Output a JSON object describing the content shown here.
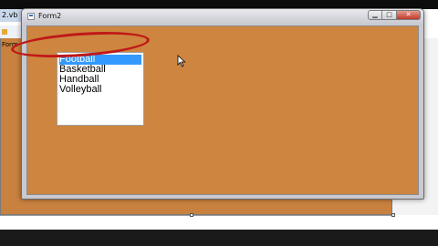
{
  "ide": {
    "document_tab": "2.vb",
    "form_tab": "Form"
  },
  "window": {
    "title": "Form2",
    "controls": {
      "minimize": "▁",
      "maximize": "□",
      "close": "✕"
    }
  },
  "listbox": {
    "items": [
      "Football",
      "Basketball",
      "Handball",
      "Volleyball"
    ],
    "selected_index": 0
  },
  "colors": {
    "form_background": "#cd853f",
    "selection": "#3399ff",
    "annotation_oval": "#c01818"
  },
  "icons": {
    "cursor": "arrow-cursor-icon",
    "form": "form-icon"
  }
}
